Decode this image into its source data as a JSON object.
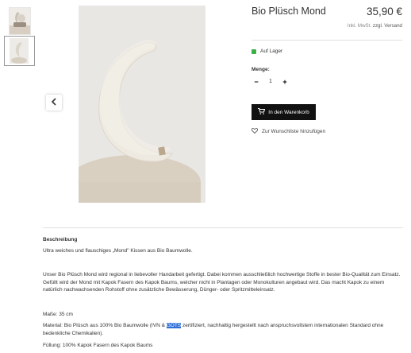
{
  "product": {
    "title": "Bio Plüsch Mond",
    "price": "35,90 €",
    "vat_prefix": "Inkl. MwSt.",
    "vat_link": "zzgl. Versand",
    "stock": "Auf Lager",
    "quantity_label": "Menge:",
    "quantity_minus": "−",
    "quantity_value": "1",
    "quantity_plus": "+",
    "add_to_cart": "In den Warenkorb",
    "wishlist": "Zur Wunschliste hinzufügen"
  },
  "gallery": {
    "prev_icon": "chevron-left-icon"
  },
  "description": {
    "heading": "Beschreibung",
    "intro": "Ultra weiches und flauschiges „Mond\" Kissen aus Bio Baumwolle.",
    "body": "Unser Bio Plüsch Mond wird regional in liebevoller Handarbeit gefertigt. Dabei kommen ausschließlich hochwertige Stoffe in bester Bio-Qualität zum Einsatz. Gefüllt wird der Mond mit Kapok Fasern des Kapok Baums, welcher nicht in Plantagen oder Monokulturen angebaut wird. Das macht Kapok zu einem natürlich nachwachsenden Rohstoff ohne zusätzliche Bewässerung, Dünger- oder Spritzmitteleinsatz.",
    "size": "Maße: 35 cm",
    "material_before": "Material: Bio Plüsch aus 100% Bio Baumwolle (IVN & ",
    "material_highlight": "GOTS",
    "material_after": " zertifiziert, nachhaltig hergestellt nach anspruchsvollstem internationalen Standard ohne bedenkliche Chemikalien).",
    "filling": "Füllung: 100% Kapok Fasern des Kapok Baums"
  },
  "colors": {
    "in_stock": "#3cb043",
    "cart_button": "#111111",
    "text_highlight": "#2f6fd6"
  }
}
